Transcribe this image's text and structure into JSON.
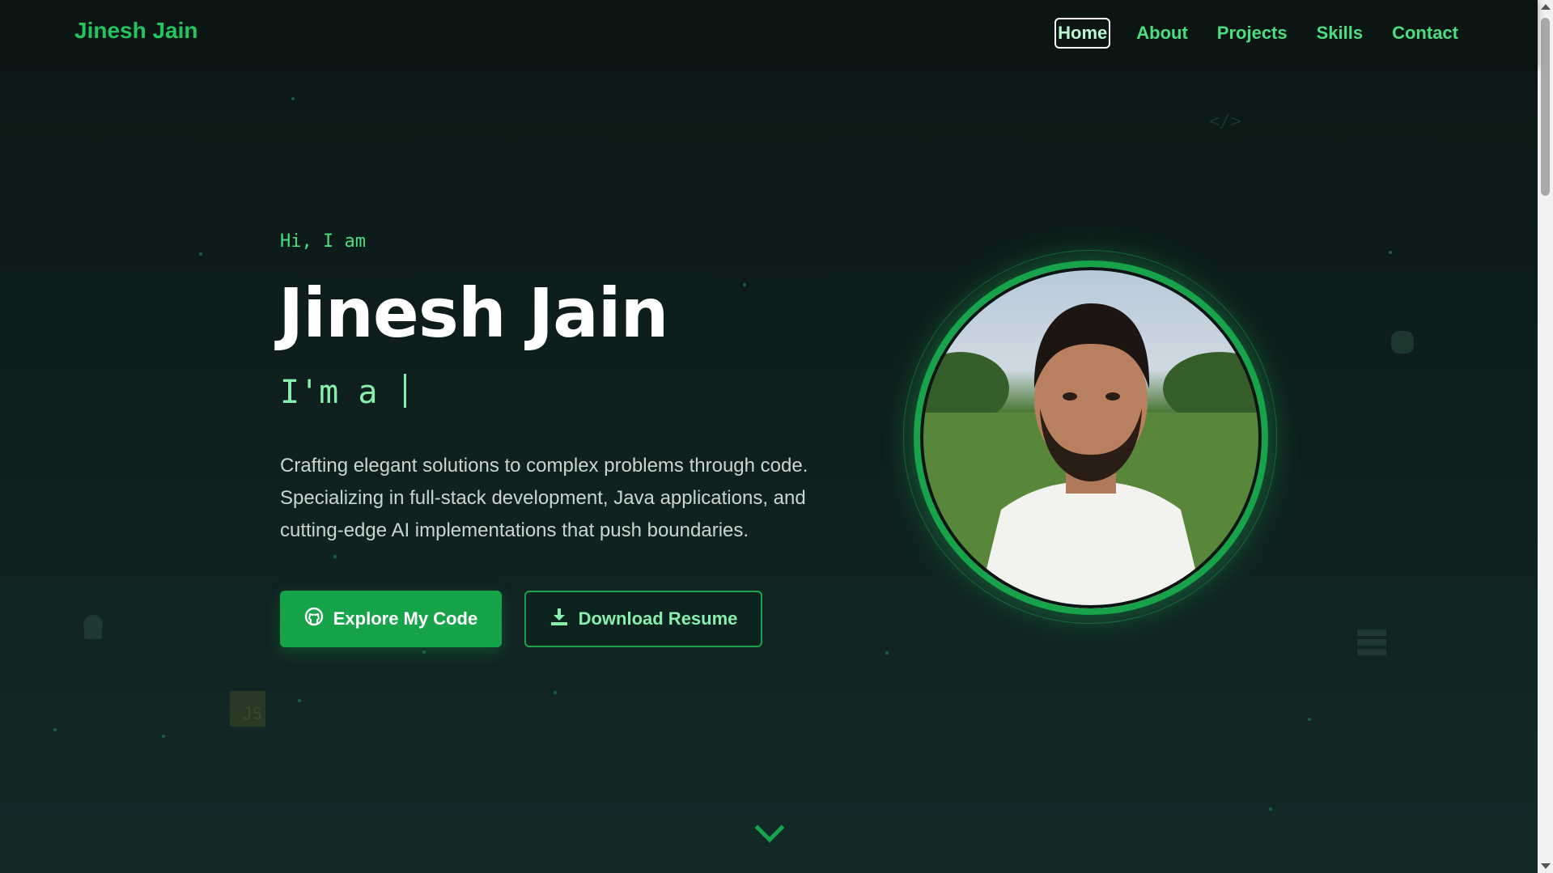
{
  "nav": {
    "brand": "Jinesh Jain",
    "links": [
      {
        "label": "Home",
        "active": true
      },
      {
        "label": "About"
      },
      {
        "label": "Projects"
      },
      {
        "label": "Skills"
      },
      {
        "label": "Contact"
      }
    ]
  },
  "hero": {
    "greeting": "Hi, I am",
    "name": "Jinesh Jain",
    "typed_prefix": "I'm a ",
    "description": "Crafting elegant solutions to complex problems through code. Specializing in full-stack development, Java applications, and cutting-edge AI implementations that push boundaries.",
    "primary_button": {
      "label": "Explore My Code",
      "icon": "github-icon"
    },
    "secondary_button": {
      "label": "Download Resume",
      "icon": "download-icon"
    },
    "portrait_icon": "profile-photo"
  },
  "decorations": {
    "icons": [
      "code-icon",
      "python-icon",
      "database-icon",
      "android-icon",
      "js-icon"
    ],
    "js_badge": "JS",
    "code_glyph": "</>"
  },
  "scroll_hint_icon": "chevron-down-icon",
  "colors": {
    "accent": "#22c55e",
    "accent_light": "#86efac",
    "background": "#0e1f1d",
    "button": "#16a34a"
  }
}
